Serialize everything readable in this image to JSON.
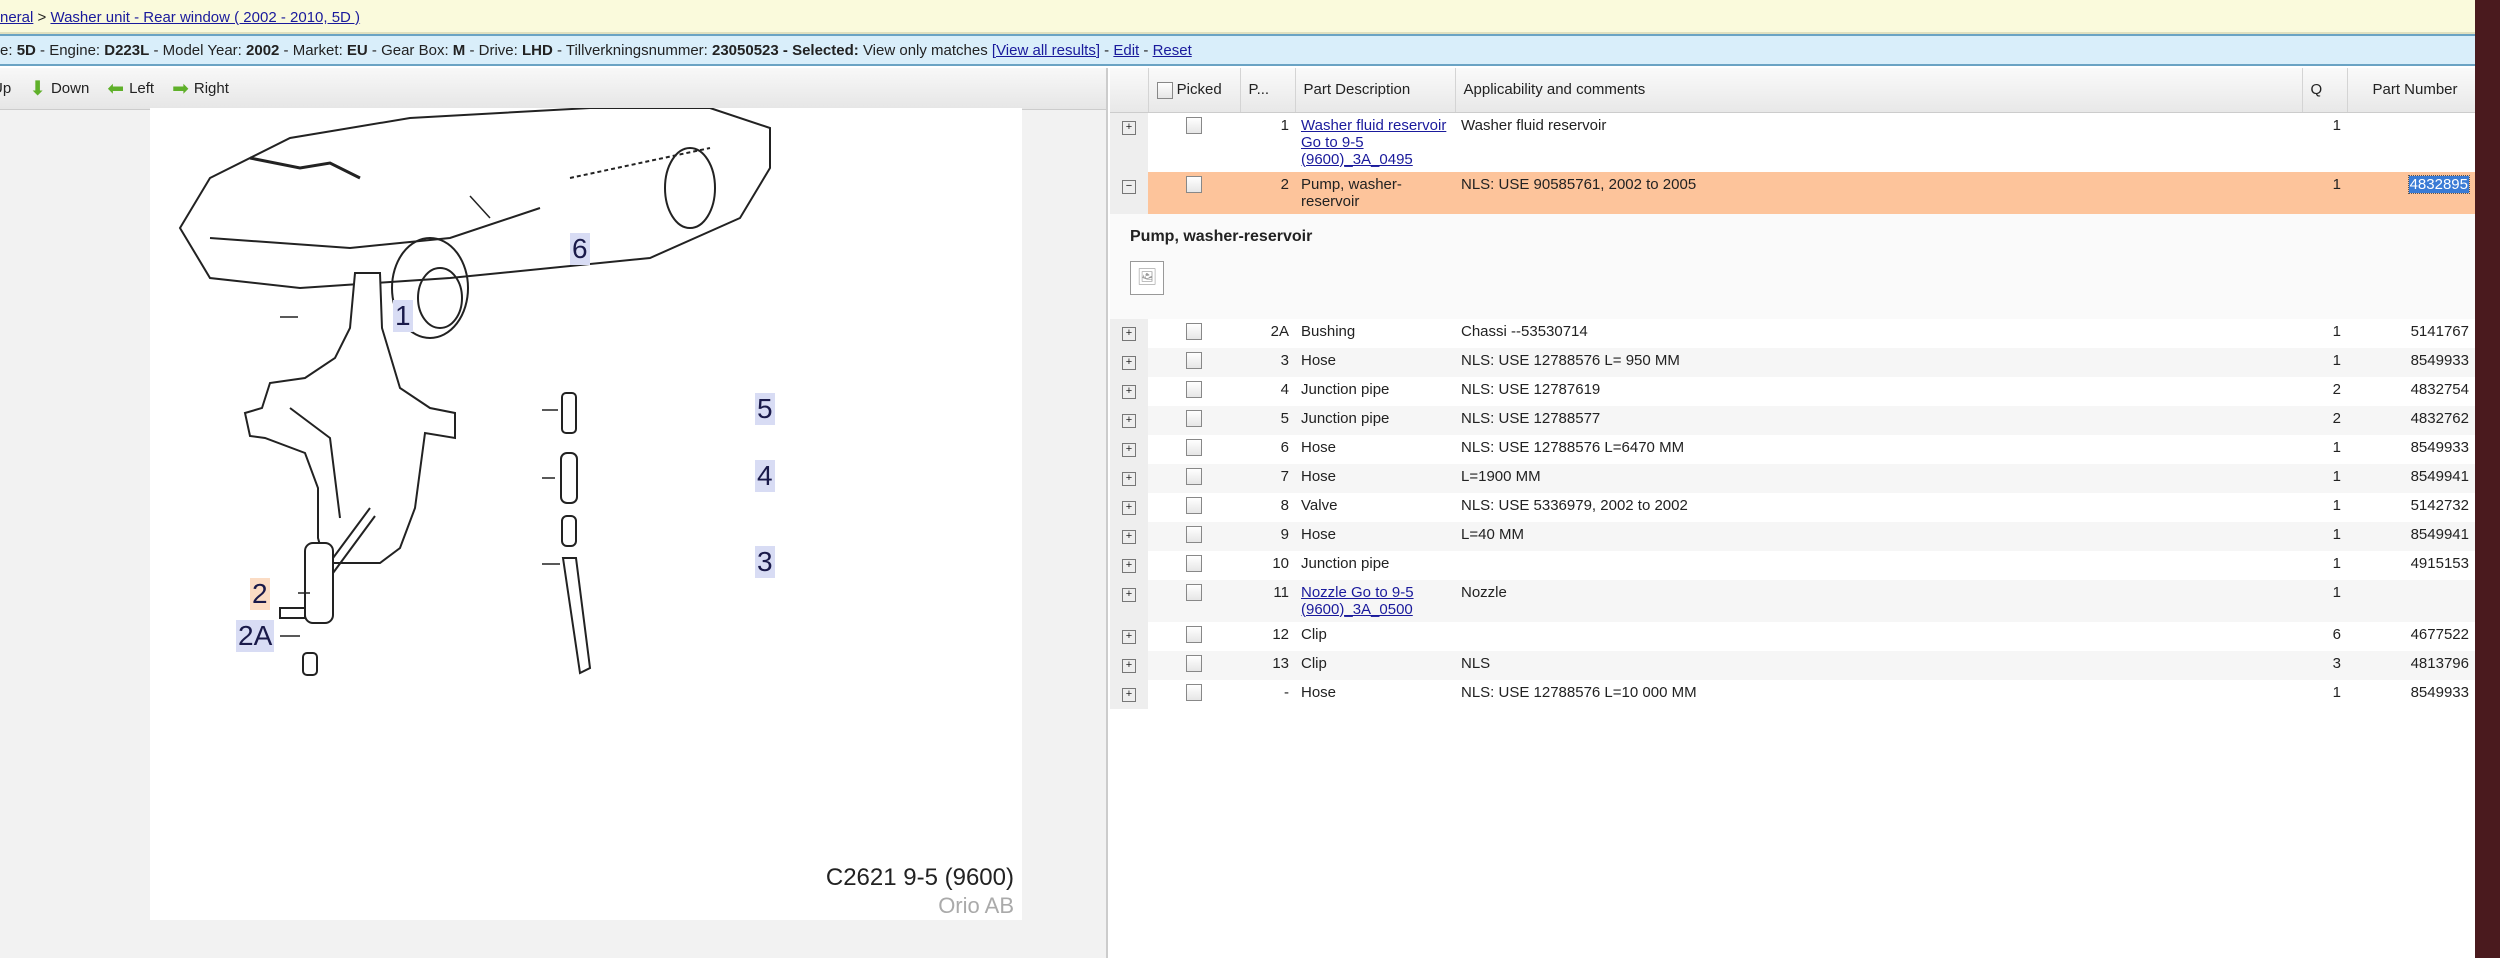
{
  "breadcrumb": {
    "parent": "neral",
    "sep": " > ",
    "current": "Washer unit - Rear window ( 2002 - 2010, 5D )"
  },
  "info": {
    "pre": "e: ",
    "body": "5D",
    "engine_l": " - Engine: ",
    "engine": "D223L",
    "year_l": " - Model Year: ",
    "year": "2002",
    "market_l": " - Market: ",
    "market": "EU",
    "gear_l": " - Gear Box: ",
    "gear": "M",
    "drive_l": " - Drive: ",
    "drive": "LHD",
    "tv_l": " - Tillverkningsnummer: ",
    "tv": "23050523",
    "sel_l": " - Selected:",
    "sel": " View only matches ",
    "view_all": "[View all results]",
    "dash1": " - ",
    "edit": "Edit",
    "dash2": " - ",
    "reset": "Reset"
  },
  "toolbar": {
    "up": "Up",
    "down": "Down",
    "left": "Left",
    "right": "Right"
  },
  "drawing": {
    "labels": [
      "1",
      "2",
      "2A",
      "3",
      "4",
      "5",
      "6"
    ],
    "code": "C2621 9-5 (9600)",
    "brand": "Orio AB"
  },
  "table": {
    "headers": {
      "picked": "Picked",
      "pos": "P...",
      "desc": "Part Description",
      "appl": "Applicability and comments",
      "q": "Q",
      "pn": "Part Number"
    },
    "rows": [
      {
        "pos": "1",
        "desc": "Washer fluid reservoir Go to 9-5 (9600)_3A_0495",
        "link": true,
        "appl": "Washer fluid reservoir",
        "q": "1",
        "pn": ""
      },
      {
        "pos": "2",
        "desc": "Pump, washer-reservoir",
        "appl": "NLS: USE 90585761, 2002 to 2005",
        "q": "1",
        "pn": "4832895",
        "selected": true
      }
    ],
    "detail": {
      "title": "Pump, washer-reservoir"
    },
    "rows2": [
      {
        "pos": "2A",
        "desc": "Bushing",
        "appl": "Chassi --53530714",
        "q": "1",
        "pn": "5141767"
      },
      {
        "pos": "3",
        "desc": "Hose",
        "appl": "NLS: USE 12788576 L= 950 MM",
        "q": "1",
        "pn": "8549933"
      },
      {
        "pos": "4",
        "desc": "Junction pipe",
        "appl": "NLS: USE 12787619",
        "q": "2",
        "pn": "4832754"
      },
      {
        "pos": "5",
        "desc": "Junction pipe",
        "appl": "NLS: USE 12788577",
        "q": "2",
        "pn": "4832762"
      },
      {
        "pos": "6",
        "desc": "Hose",
        "appl": "NLS: USE 12788576 L=6470 MM",
        "q": "1",
        "pn": "8549933"
      },
      {
        "pos": "7",
        "desc": "Hose",
        "appl": "L=1900 MM",
        "q": "1",
        "pn": "8549941"
      },
      {
        "pos": "8",
        "desc": "Valve",
        "appl": "NLS: USE 5336979, 2002 to 2002",
        "q": "1",
        "pn": "5142732"
      },
      {
        "pos": "9",
        "desc": "Hose",
        "appl": "L=40 MM",
        "q": "1",
        "pn": "8549941"
      },
      {
        "pos": "10",
        "desc": "Junction pipe",
        "appl": "",
        "q": "1",
        "pn": "4915153"
      },
      {
        "pos": "11",
        "desc": "Nozzle Go to 9-5 (9600)_3A_0500",
        "link": true,
        "appl": "Nozzle",
        "q": "1",
        "pn": ""
      },
      {
        "pos": "12",
        "desc": "Clip",
        "appl": "",
        "q": "6",
        "pn": "4677522"
      },
      {
        "pos": "13",
        "desc": "Clip",
        "appl": "NLS",
        "q": "3",
        "pn": "4813796"
      },
      {
        "pos": "-",
        "desc": "Hose",
        "appl": "NLS: USE 12788576 L=10 000 MM",
        "q": "1",
        "pn": "8549933"
      }
    ]
  },
  "colors": {
    "selected_row": "#fdc49b",
    "info_bar": "#d9eefa",
    "crumb_bar": "#fafadc"
  }
}
